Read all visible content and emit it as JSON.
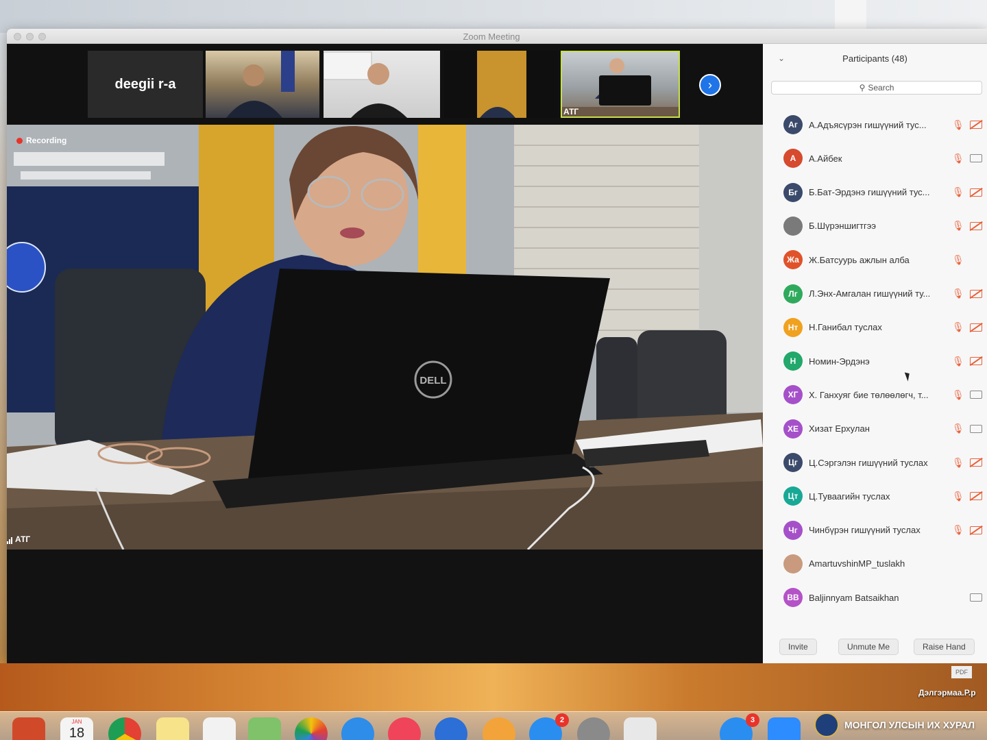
{
  "window": {
    "title": "Zoom Meeting"
  },
  "thumbnails": [
    {
      "type": "name",
      "label": "deegii r-a"
    },
    {
      "type": "video",
      "label": ""
    },
    {
      "type": "video",
      "label": ""
    },
    {
      "type": "video",
      "label": ""
    },
    {
      "type": "video",
      "label": "АТГ",
      "active": true
    }
  ],
  "main_video": {
    "recording_label": "Recording",
    "speaker_label": "АТГ"
  },
  "panel": {
    "title": "Participants (48)",
    "search_label": "Search",
    "participants": [
      {
        "initials": "Аг",
        "color": "#3b4a6b",
        "name": "А.Адъясүрэн гишүүний тус...",
        "mic": "muted",
        "cam": "off"
      },
      {
        "initials": "А",
        "color": "#d64a2e",
        "name": "А.Айбек",
        "mic": "muted",
        "cam": "on"
      },
      {
        "initials": "Бг",
        "color": "#3b4a6b",
        "name": "Б.Бат-Эрдэнэ гишүүний тус...",
        "mic": "muted",
        "cam": "off"
      },
      {
        "initials": "",
        "color": "#7a7a7a",
        "name": "Б.Шүрэншигтгээ",
        "mic": "muted",
        "cam": "off"
      },
      {
        "initials": "Жа",
        "color": "#e0522a",
        "name": "Ж.Батсуурь ажлын алба",
        "mic": "muted",
        "cam": ""
      },
      {
        "initials": "Лг",
        "color": "#2faa5c",
        "name": "Л.Энх-Амгалан гишүүний ту...",
        "mic": "muted",
        "cam": "off"
      },
      {
        "initials": "Нт",
        "color": "#f0a11f",
        "name": "Н.Ганибал туслах",
        "mic": "muted",
        "cam": "off"
      },
      {
        "initials": "Н",
        "color": "#22a86a",
        "name": "Номин-Эрдэнэ",
        "mic": "muted",
        "cam": "off"
      },
      {
        "initials": "ХГ",
        "color": "#a550c9",
        "name": "Х. Ганхуяг бие төлөөлөгч, т...",
        "mic": "muted",
        "cam": "on"
      },
      {
        "initials": "ХЕ",
        "color": "#a550c9",
        "name": "Хизат Ерхулан",
        "mic": "muted",
        "cam": "on"
      },
      {
        "initials": "Цг",
        "color": "#3b4a6b",
        "name": "Ц.Сэргэлэн гишүүний туслах",
        "mic": "muted",
        "cam": "off"
      },
      {
        "initials": "Цт",
        "color": "#18a896",
        "name": "Ц.Туваагийн туслах",
        "mic": "muted",
        "cam": "off"
      },
      {
        "initials": "Чг",
        "color": "#a550c9",
        "name": "Чинбүрэн гишүүний туслах",
        "mic": "muted",
        "cam": "off"
      },
      {
        "initials": "",
        "color": "#c99a7d",
        "name": "AmartuvshinMP_tuslakh",
        "mic": "",
        "cam": ""
      },
      {
        "initials": "BB",
        "color": "#b452c7",
        "name": "Baljinnyam Batsaikhan",
        "mic": "",
        "cam": "on"
      }
    ],
    "footer": {
      "invite": "Invite",
      "unmute": "Unmute Me",
      "raise_hand": "Raise Hand"
    }
  },
  "desktop": {
    "file_label": "Дэлгэрмаа.Р.р",
    "pdf_label": "PDF",
    "watermark": "МОНГОЛ УЛСЫН ИХ ХУРАЛ",
    "dock_badges": [
      "2",
      "3"
    ],
    "calendar": {
      "month": "JAN",
      "day": "18"
    }
  }
}
